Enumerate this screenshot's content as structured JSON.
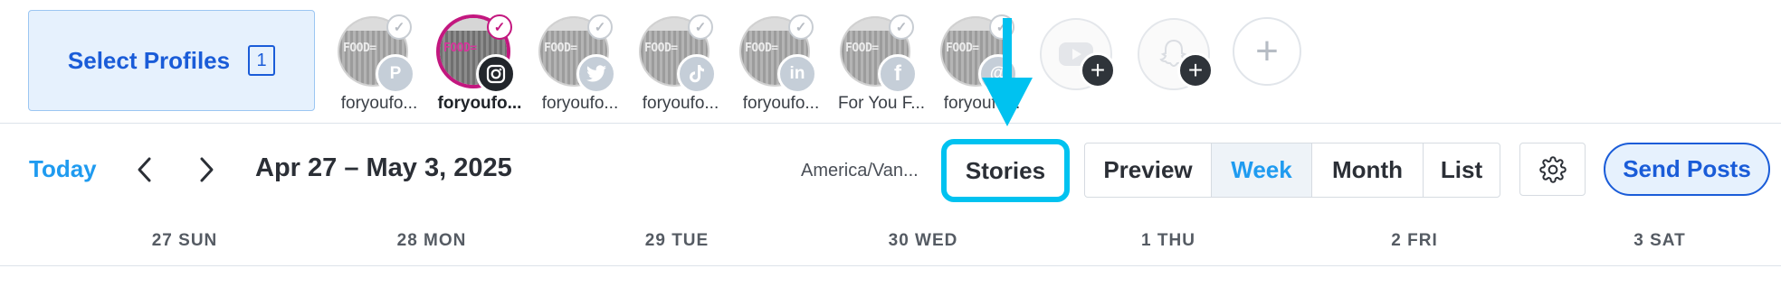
{
  "profile_bar": {
    "select_profiles_label": "Select Profiles",
    "selected_count": "1",
    "profiles": [
      {
        "name": "foryoufo...",
        "network": "pinterest",
        "net_glyph": "P",
        "active": false
      },
      {
        "name": "foryoufo...",
        "network": "instagram",
        "net_glyph": "◎",
        "active": true
      },
      {
        "name": "foryoufo...",
        "network": "twitter",
        "net_glyph": "t",
        "active": false
      },
      {
        "name": "foryoufo...",
        "network": "tiktok",
        "net_glyph": "♪",
        "active": false
      },
      {
        "name": "foryoufo...",
        "network": "linkedin",
        "net_glyph": "in",
        "active": false
      },
      {
        "name": "For You F...",
        "network": "facebook",
        "net_glyph": "f",
        "active": false
      },
      {
        "name": "foryoufo...",
        "network": "threads",
        "net_glyph": "@",
        "active": false
      }
    ],
    "avatar_text": "FOOD=",
    "add_slots": [
      {
        "network": "youtube"
      },
      {
        "network": "snapchat"
      }
    ],
    "add_profile_glyph": "+"
  },
  "toolbar": {
    "today_label": "Today",
    "date_range": "Apr 27 – May 3, 2025",
    "timezone": "America/Van...",
    "stories_label": "Stories",
    "views": [
      {
        "label": "Preview",
        "active": false
      },
      {
        "label": "Week",
        "active": true
      },
      {
        "label": "Month",
        "active": false
      },
      {
        "label": "List",
        "active": false
      }
    ],
    "send_posts_label": "Send Posts"
  },
  "days": [
    "27 SUN",
    "28 MON",
    "29 TUE",
    "30 WED",
    "1 THU",
    "2 FRI",
    "3 SAT"
  ],
  "colors": {
    "accent_blue": "#1f9bf0",
    "brand_blue": "#1a5cd8",
    "annotation_cyan": "#00c2f0",
    "instagram_ring": "#c3177f"
  }
}
